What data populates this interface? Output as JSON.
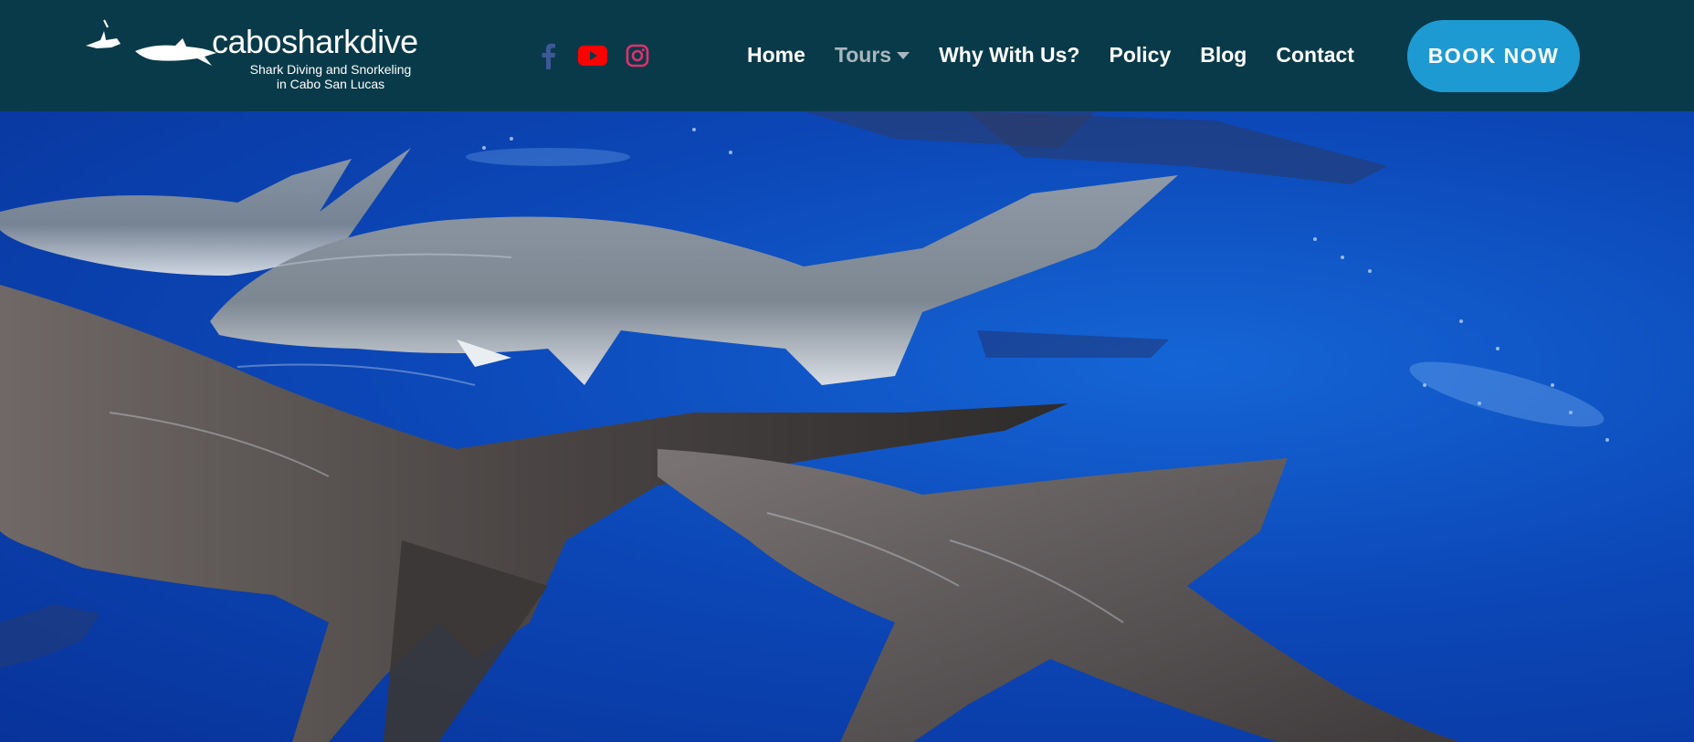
{
  "brand": {
    "name": "cabosharkdive",
    "tagline_line1": "Shark Diving and Snorkeling",
    "tagline_line2": "in Cabo San Lucas"
  },
  "social": {
    "facebook": {
      "icon": "facebook-icon",
      "color": "#3b5998"
    },
    "youtube": {
      "icon": "youtube-icon",
      "color": "#ff0000"
    },
    "instagram": {
      "icon": "instagram-icon",
      "color": "#e1306c"
    }
  },
  "nav": {
    "items": [
      {
        "label": "Home"
      },
      {
        "label": "Tours",
        "active": true,
        "has_dropdown": true
      },
      {
        "label": "Why With Us?"
      },
      {
        "label": "Policy"
      },
      {
        "label": "Blog"
      },
      {
        "label": "Contact"
      }
    ],
    "cta_label": "BOOK NOW"
  },
  "colors": {
    "header_bg": "#093a49",
    "cta_bg": "#1e9ad2",
    "ocean": "#0c48b8"
  }
}
